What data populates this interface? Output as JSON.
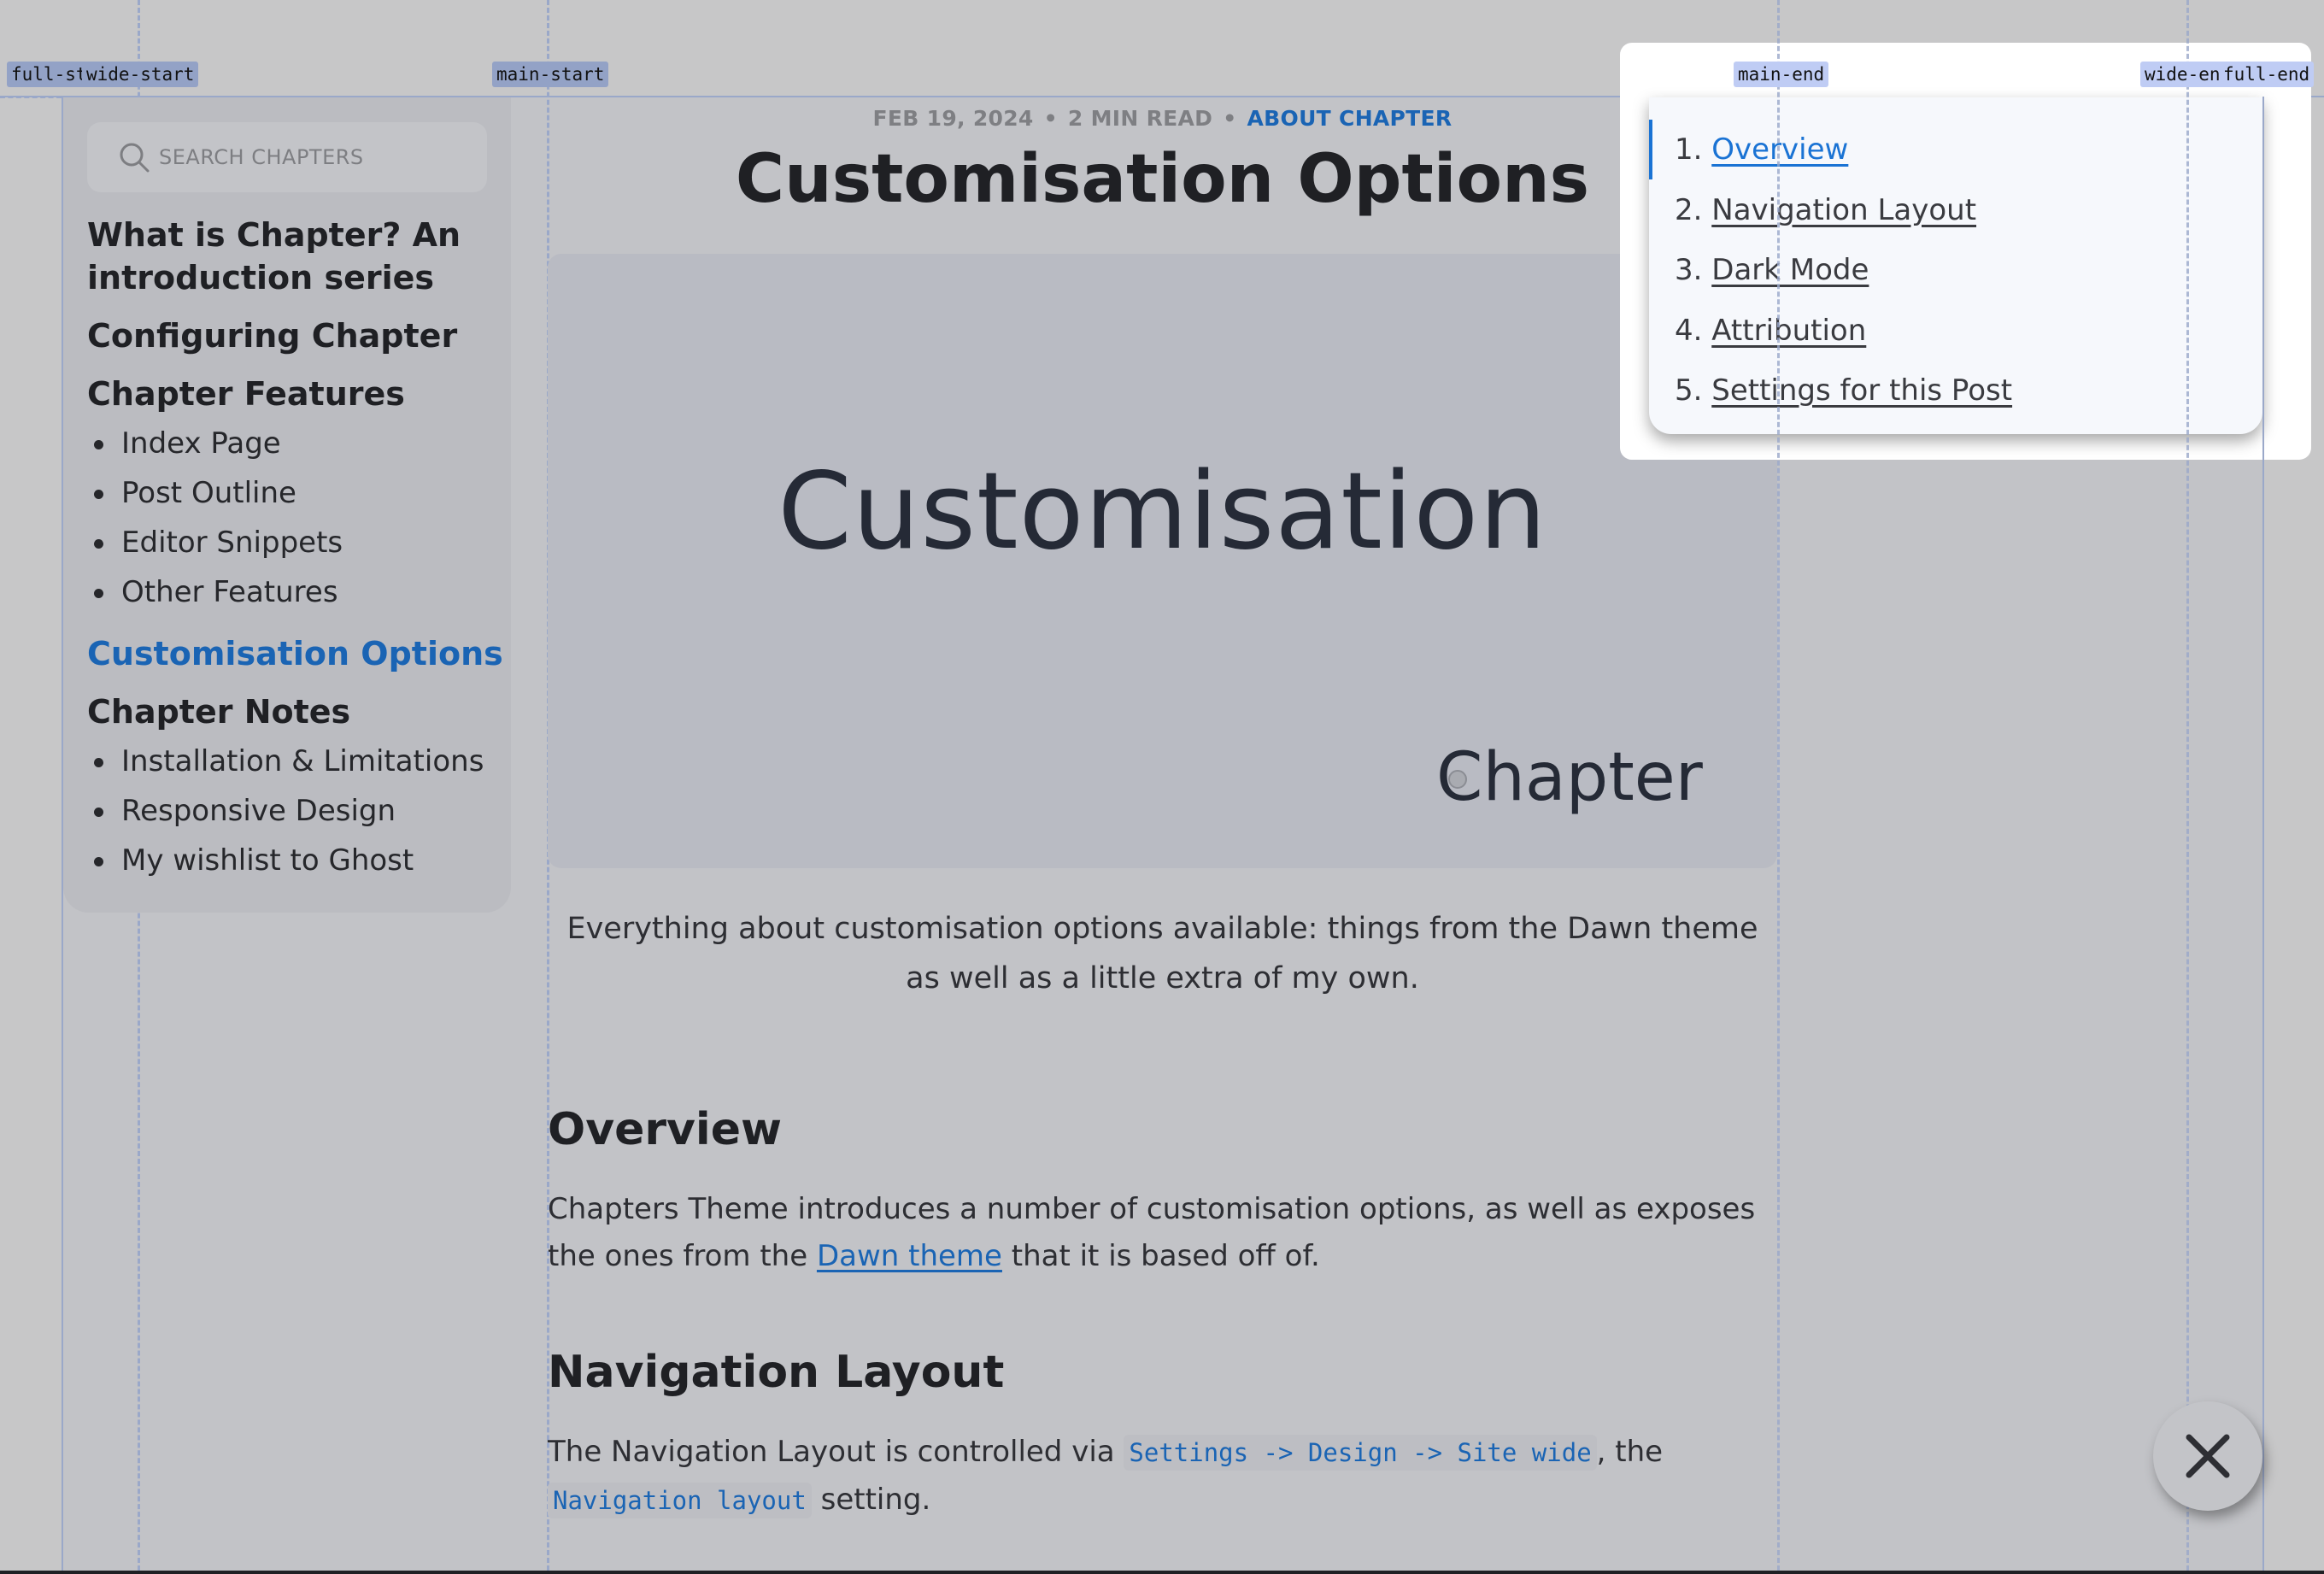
{
  "grid_labels": {
    "full_start": "full-st",
    "wide_start": "wide-start",
    "main_start": "main-start",
    "main_end": "main-end",
    "wide_end": "wide-en",
    "full_end": "full-end"
  },
  "sidebar": {
    "search_placeholder": "SEARCH CHAPTERS",
    "sections": [
      {
        "title": "What is Chapter? An introduction series",
        "items": []
      },
      {
        "title": "Configuring Chapter",
        "items": []
      },
      {
        "title": "Chapter Features",
        "items": [
          "Index Page",
          "Post Outline",
          "Editor Snippets",
          "Other Features"
        ]
      },
      {
        "title": "Customisation Options",
        "active": true,
        "items": []
      },
      {
        "title": "Chapter Notes",
        "items": [
          "Installation & Limitations",
          "Responsive Design",
          "My wishlist to Ghost"
        ]
      }
    ]
  },
  "post": {
    "date": "FEB 19, 2024",
    "read_time": "2 MIN READ",
    "tag": "ABOUT CHAPTER",
    "separator": "•",
    "title": "Customisation Options",
    "hero": {
      "word": "Customisation",
      "logo": "Chapter",
      "logo_first": "C",
      "logo_rest": "hapter"
    },
    "excerpt": "Everything about customisation options available: things from the Dawn theme as well as a little extra of my own.",
    "sections": [
      {
        "heading": "Overview",
        "text_before": "Chapters Theme introduces a number of customisation options, as well as exposes the ones from the ",
        "link": "Dawn theme",
        "text_after": " that it is based off of."
      },
      {
        "heading": "Navigation Layout",
        "text_before": "The Navigation Layout is controlled via ",
        "code1": "Settings -> Design -> Site wide",
        "text_mid": ", the ",
        "code2": "Navigation layout",
        "text_after": " setting."
      }
    ]
  },
  "toc": {
    "items": [
      {
        "num": "1.",
        "label": "Overview",
        "active": true
      },
      {
        "num": "2.",
        "label": "Navigation Layout"
      },
      {
        "num": "3.",
        "label": "Dark Mode"
      },
      {
        "num": "4.",
        "label": "Attribution"
      },
      {
        "num": "5.",
        "label": "Settings for this Post"
      }
    ]
  },
  "close_button": {
    "icon": "close-icon"
  },
  "colors": {
    "accent": "#1a64b4",
    "toc_active": "#1a73d4",
    "grid": "#9aa8c9",
    "label_bg": "#93a2c6"
  }
}
